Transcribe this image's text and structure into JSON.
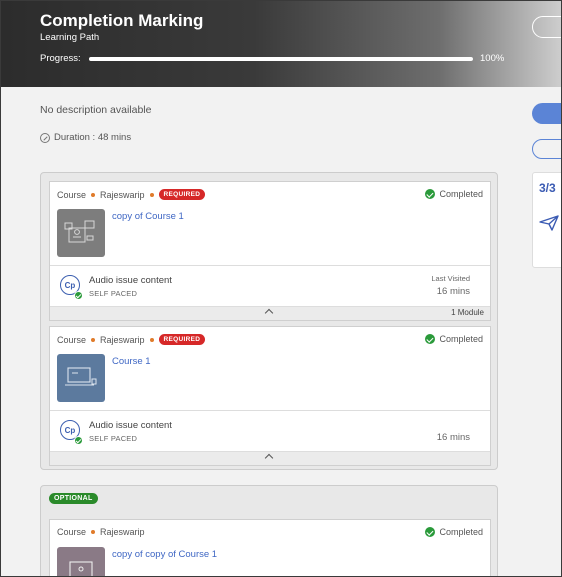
{
  "header": {
    "title": "Completion Marking",
    "subtitle": "Learning Path",
    "progress_label": "Progress:",
    "progress_percent": "100%",
    "progress_value": 100
  },
  "main": {
    "description": "No description available",
    "duration": "Duration : 48 mins"
  },
  "side_panel": {
    "count": "3/3",
    "accent_color": "#5b84d6"
  },
  "sections": [
    {
      "cards": [
        {
          "type": "Course",
          "author": "Rajeswarip",
          "badge": "REQUIRED",
          "status": "Completed",
          "title": "copy of Course 1",
          "thumb_icon": "classroom-icon",
          "module": {
            "title": "Audio issue content",
            "subtitle": "SELF PACED",
            "last_visited": "Last Visited",
            "time": "16 mins"
          },
          "module_count": "1 Module"
        },
        {
          "type": "Course",
          "author": "Rajeswarip",
          "badge": "REQUIRED",
          "status": "Completed",
          "title": "Course 1",
          "thumb_icon": "laptop-icon",
          "module": {
            "title": "Audio issue content",
            "subtitle": "SELF PACED",
            "time": "16 mins"
          }
        }
      ]
    },
    {
      "badge": "OPTIONAL",
      "cards": [
        {
          "type": "Course",
          "author": "Rajeswarip",
          "status": "Completed",
          "title": "copy of copy of Course 1",
          "thumb_icon": "laptop-icon"
        }
      ]
    }
  ],
  "colors": {
    "required": "#d62828",
    "optional": "#2a8a2a",
    "completed": "#2a9a3a",
    "link": "#3f67c4"
  }
}
